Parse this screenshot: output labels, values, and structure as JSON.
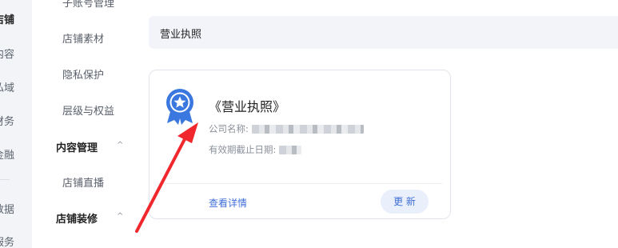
{
  "rail": {
    "items": [
      {
        "label": "店铺",
        "active": true
      },
      {
        "label": "内容",
        "active": false
      },
      {
        "label": "私域",
        "active": false
      },
      {
        "label": "财务",
        "active": false
      },
      {
        "label": "金融",
        "active": false
      },
      {
        "label": "数据",
        "active": false
      },
      {
        "label": "服务",
        "active": false
      }
    ]
  },
  "sidebar": {
    "top_cut": "子账号管理",
    "items": [
      "店铺素材",
      "隐私保护",
      "层级与权益"
    ],
    "group_content": {
      "label": "内容管理",
      "caret": "^",
      "items": [
        "店铺直播"
      ]
    },
    "group_decoration": {
      "label": "店铺装修",
      "caret": "^"
    }
  },
  "main": {
    "section_title": "营业执照",
    "card": {
      "icon": "license-badge-icon",
      "title": "《营业执照》",
      "company_label": "公司名称:",
      "validity_label": "有效期截止日期:",
      "link": "查看详情",
      "button": "更 新"
    }
  },
  "colors": {
    "accent": "#3f6ed8",
    "badge": "#3a78e0",
    "arrow": "#f0282d"
  }
}
